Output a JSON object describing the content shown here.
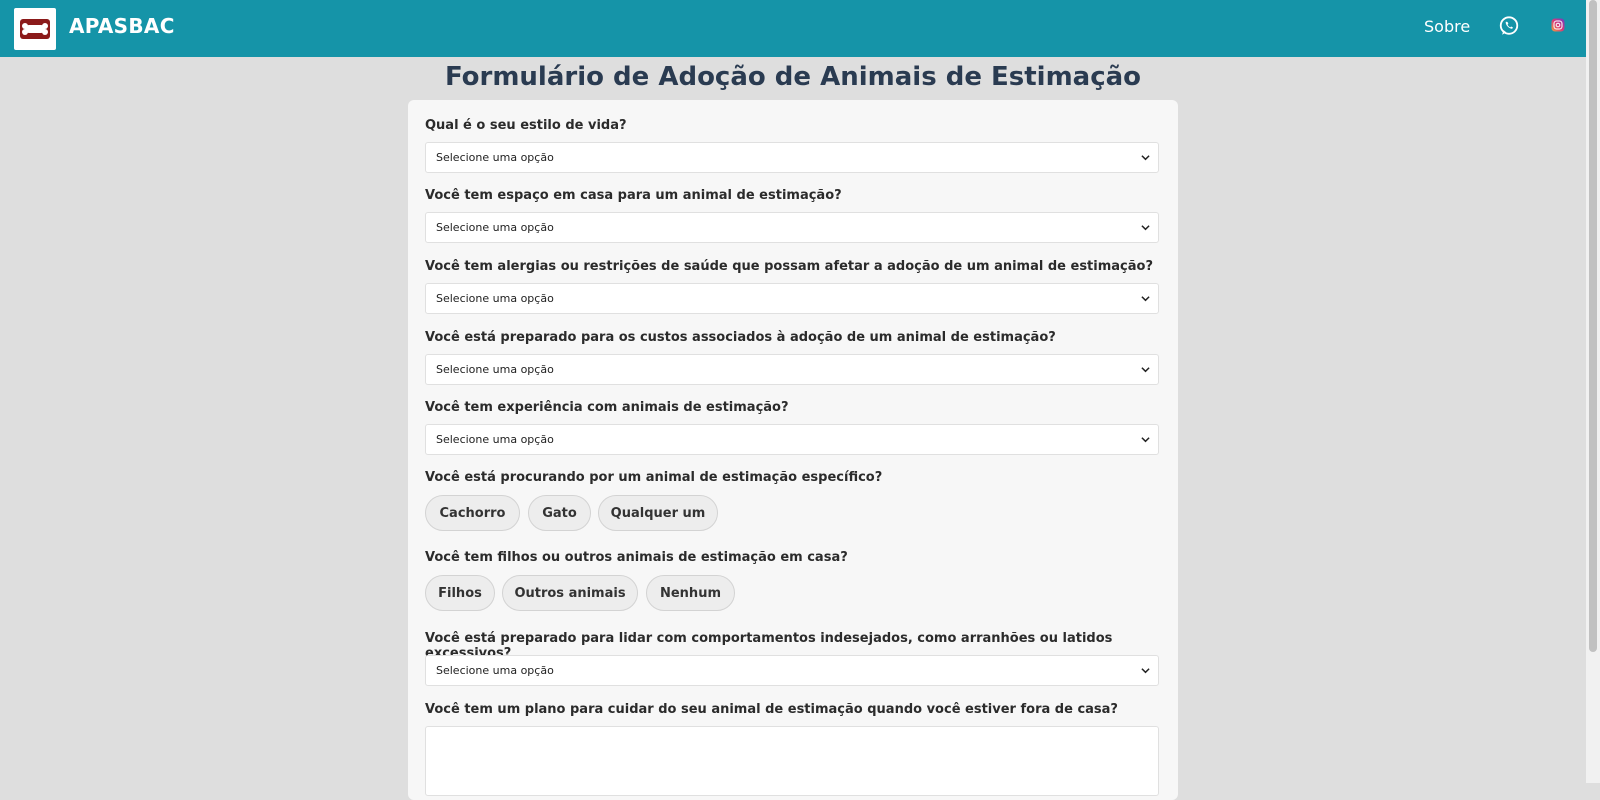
{
  "header": {
    "brand": "APASBAC",
    "nav_sobre": "Sobre",
    "icons": [
      "whatsapp-icon",
      "instagram-icon"
    ],
    "color": "#1594a8"
  },
  "page": {
    "title": "Formulário de Adoção de Animais de Estimação"
  },
  "form": {
    "questions": [
      {
        "label": "Qual é o seu estilo de vida?",
        "type": "select",
        "value": "Selecione uma opção"
      },
      {
        "label": "Você tem espaço em casa para um animal de estimação?",
        "type": "select",
        "value": "Selecione uma opção"
      },
      {
        "label": "Você tem alergias ou restrições de saúde que possam afetar a adoção de um animal de estimação?",
        "type": "select",
        "value": "Selecione uma opção"
      },
      {
        "label": "Você está preparado para os custos associados à adoção de um animal de estimação?",
        "type": "select",
        "value": "Selecione uma opção"
      },
      {
        "label": "Você tem experiência com animais de estimação?",
        "type": "select",
        "value": "Selecione uma opção"
      },
      {
        "label": "Você está procurando por um animal de estimação específico?",
        "type": "choice",
        "options": [
          "Cachorro",
          "Gato",
          "Qualquer um"
        ]
      },
      {
        "label": "Você tem filhos ou outros animais de estimação em casa?",
        "type": "choice",
        "options": [
          "Filhos",
          "Outros animais",
          "Nenhum"
        ]
      },
      {
        "label": "Você está preparado para lidar com comportamentos indesejados, como arranhões ou latidos excessivos?",
        "type": "select",
        "value": "Selecione uma opção"
      },
      {
        "label": "Você tem um plano para cuidar do seu animal de estimação quando você estiver fora de casa?",
        "type": "textarea",
        "value": ""
      }
    ]
  }
}
